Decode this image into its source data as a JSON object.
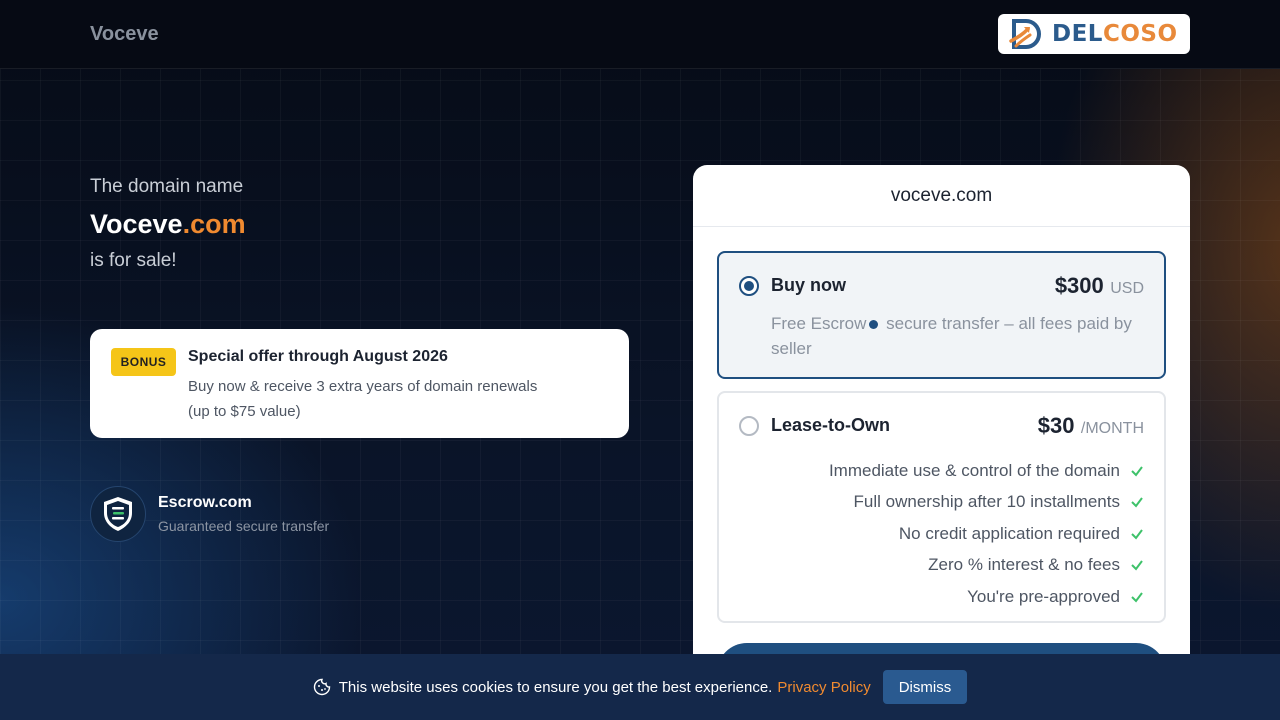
{
  "header": {
    "site_name": "Voceve",
    "logo": {
      "brand_a": "DEL",
      "brand_b": "COSO",
      "icon": "delcoso-logo-icon"
    }
  },
  "intro": {
    "line1": "The domain name",
    "domain_name": "Voceve",
    "domain_tld": ".com",
    "line3": "is for sale!"
  },
  "bonus": {
    "badge": "BONUS",
    "title": "Special offer through August 2026",
    "desc_line1": "Buy now & receive 3 extra years of domain renewals",
    "desc_line2": "(up to $75 value)"
  },
  "escrow": {
    "icon": "shield-icon",
    "title": "Escrow.com",
    "subtitle": "Guaranteed secure transfer"
  },
  "panel": {
    "domain": "voceve.com",
    "buy": {
      "label": "Buy now",
      "price": "$300",
      "currency": "USD",
      "desc_a": "Free Escrow",
      "desc_b": "secure transfer – all fees paid by seller",
      "selected": true
    },
    "lease": {
      "label": "Lease-to-Own",
      "price": "$30",
      "period": "/MONTH",
      "features": [
        "Immediate use & control of the domain",
        "Full ownership after 10 installments",
        "No credit application required",
        "Zero % interest & no fees",
        "You're pre-approved"
      ]
    }
  },
  "cookie": {
    "icon": "cookie-icon",
    "text": "This website uses cookies to ensure you get the best experience.",
    "link": "Privacy Policy",
    "dismiss": "Dismiss"
  },
  "colors": {
    "accent": "#f08a30",
    "primary": "#1f4f80",
    "badge": "#f5c518"
  }
}
